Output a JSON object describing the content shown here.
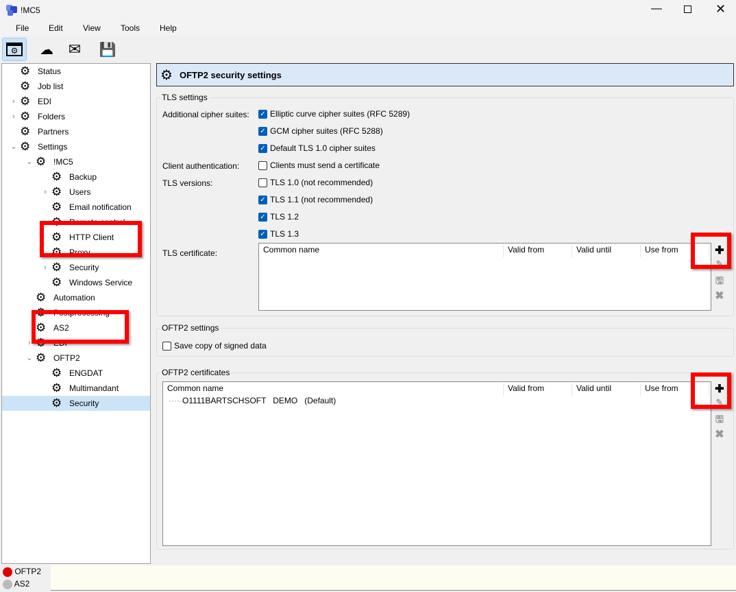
{
  "window": {
    "title": "!MC5"
  },
  "menu": [
    "File",
    "Edit",
    "View",
    "Tools",
    "Help"
  ],
  "tree": [
    {
      "label": "Status",
      "level": 0,
      "exp": ""
    },
    {
      "label": "Job list",
      "level": 0,
      "exp": ""
    },
    {
      "label": "EDI",
      "level": 0,
      "exp": ">"
    },
    {
      "label": "Folders",
      "level": 0,
      "exp": ">"
    },
    {
      "label": "Partners",
      "level": 0,
      "exp": ""
    },
    {
      "label": "Settings",
      "level": 0,
      "exp": "v"
    },
    {
      "label": "!MC5",
      "level": 1,
      "exp": "v"
    },
    {
      "label": "Backup",
      "level": 2,
      "exp": ""
    },
    {
      "label": "Users",
      "level": 2,
      "exp": ">"
    },
    {
      "label": "Email notification",
      "level": 2,
      "exp": ""
    },
    {
      "label": "Remote control",
      "level": 2,
      "exp": ""
    },
    {
      "label": "HTTP Client",
      "level": 2,
      "exp": ""
    },
    {
      "label": "Proxy",
      "level": 2,
      "exp": ""
    },
    {
      "label": "Security",
      "level": 2,
      "exp": ">"
    },
    {
      "label": "Windows Service",
      "level": 2,
      "exp": ""
    },
    {
      "label": "Automation",
      "level": 1,
      "exp": ""
    },
    {
      "label": "Postprocessing",
      "level": 1,
      "exp": ""
    },
    {
      "label": "AS2",
      "level": 1,
      "exp": ""
    },
    {
      "label": "EDI",
      "level": 1,
      "exp": ">"
    },
    {
      "label": "OFTP2",
      "level": 1,
      "exp": "v"
    },
    {
      "label": "ENGDAT",
      "level": 2,
      "exp": ""
    },
    {
      "label": "Multimandant",
      "level": 2,
      "exp": ""
    },
    {
      "label": "Security",
      "level": 2,
      "exp": "",
      "selected": true
    }
  ],
  "header": {
    "title": "OFTP2 security settings"
  },
  "tls": {
    "group_label": "TLS settings",
    "cipher_label": "Additional cipher suites:",
    "ciphers": [
      {
        "label": "Elliptic curve cipher suites (RFC 5289)",
        "checked": true
      },
      {
        "label": "GCM cipher suites (RFC 5288)",
        "checked": true
      },
      {
        "label": "Default TLS 1.0 cipher suites",
        "checked": true
      }
    ],
    "client_auth_label": "Client authentication:",
    "client_auth": {
      "label": "Clients must send a certificate",
      "checked": false
    },
    "versions_label": "TLS versions:",
    "versions": [
      {
        "label": "TLS 1.0 (not recommended)",
        "checked": false
      },
      {
        "label": "TLS 1.1 (not recommended)",
        "checked": true
      },
      {
        "label": "TLS 1.2",
        "checked": true
      },
      {
        "label": "TLS 1.3",
        "checked": true
      }
    ],
    "cert_label": "TLS certificate:",
    "columns": [
      "Common name",
      "Valid from",
      "Valid until",
      "Use from"
    ]
  },
  "oftp2": {
    "group_label": "OFTP2 settings",
    "save_copy": {
      "label": "Save copy of signed data",
      "checked": false
    }
  },
  "certs": {
    "group_label": "OFTP2 certificates",
    "columns": [
      "Common name",
      "Valid from",
      "Valid until",
      "Use from"
    ],
    "rows": [
      "O1111BARTSCHSOFT   DEMO   (Default)"
    ]
  },
  "status": {
    "items": [
      {
        "label": "OFTP2",
        "color": "#e00000"
      },
      {
        "label": "AS2",
        "color": "#bbbbbb"
      }
    ]
  }
}
